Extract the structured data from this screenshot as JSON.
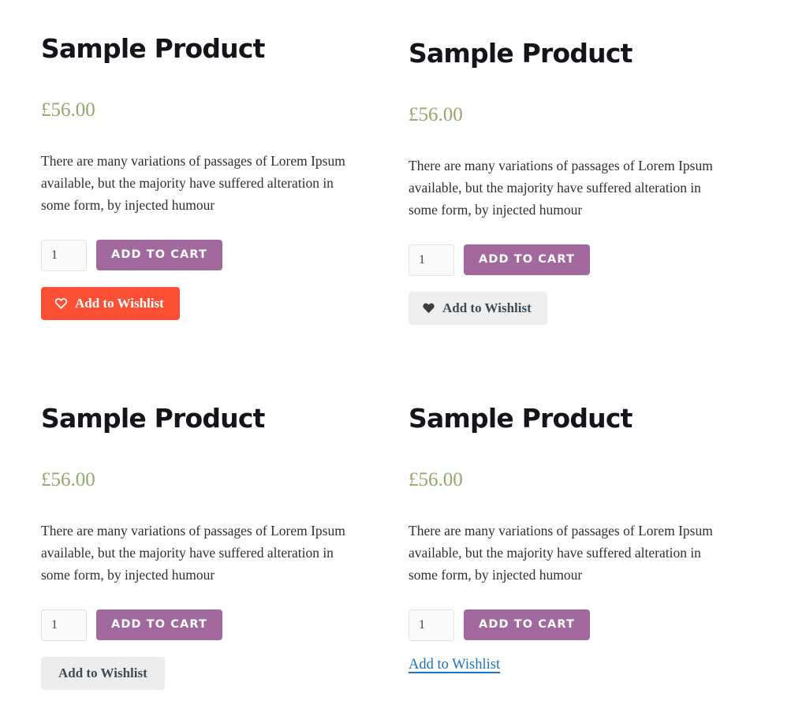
{
  "page": {
    "background_color": "#ffffff",
    "accent_purple": "#a1699d",
    "accent_orange": "#fb5034",
    "price_green": "#92a96c",
    "link_blue": "#1d74bd",
    "grey_button": "#eeeeee"
  },
  "shared": {
    "title": "Sample Product",
    "price": "£56.00",
    "description": "There are many variations of passages of Lorem Ipsum available, but the majority have suffered alteration in some form, by injected humour",
    "quantity_value": "1",
    "quantity_placeholder": "1",
    "add_to_cart_label": "ADD TO CART",
    "wishlist_label": "Add to Wishlist"
  },
  "products": [
    {
      "id": "product-1",
      "title": "Sample Product",
      "price": "£56.00",
      "description": "There are many variations of passages of Lorem Ipsum available, but the majority have suffered alteration in some form, by injected humour",
      "quantity": "1",
      "add_to_cart_label": "ADD TO CART",
      "wishlist": {
        "label": "Add to Wishlist",
        "style": "solid-orange",
        "icon": "heart-outline-icon",
        "background_color": "#fb5034",
        "text_color": "#ffffff"
      }
    },
    {
      "id": "product-2",
      "title": "Sample Product",
      "price": "£56.00",
      "description": "There are many variations of passages of Lorem Ipsum available, but the majority have suffered alteration in some form, by injected humour",
      "quantity": "1",
      "add_to_cart_label": "ADD TO CART",
      "wishlist": {
        "label": "Add to Wishlist",
        "style": "grey-with-icon",
        "icon": "heart-filled-icon",
        "background_color": "#eeeeee",
        "text_color": "#3d4b55"
      }
    },
    {
      "id": "product-3",
      "title": "Sample Product",
      "price": "£56.00",
      "description": "There are many variations of passages of Lorem Ipsum available, but the majority have suffered alteration in some form, by injected humour",
      "quantity": "1",
      "add_to_cart_label": "ADD TO CART",
      "wishlist": {
        "label": "Add to Wishlist",
        "style": "grey-no-icon",
        "icon": "none",
        "background_color": "#ededed",
        "text_color": "#3d4b55"
      }
    },
    {
      "id": "product-4",
      "title": "Sample Product",
      "price": "£56.00",
      "description": "There are many variations of passages of Lorem Ipsum available, but the majority have suffered alteration in some form, by injected humour",
      "quantity": "1",
      "add_to_cart_label": "ADD TO CART",
      "wishlist": {
        "label": "Add to Wishlist",
        "style": "text-link",
        "icon": "none",
        "background_color": "transparent",
        "text_color": "#1d74bd"
      }
    }
  ]
}
